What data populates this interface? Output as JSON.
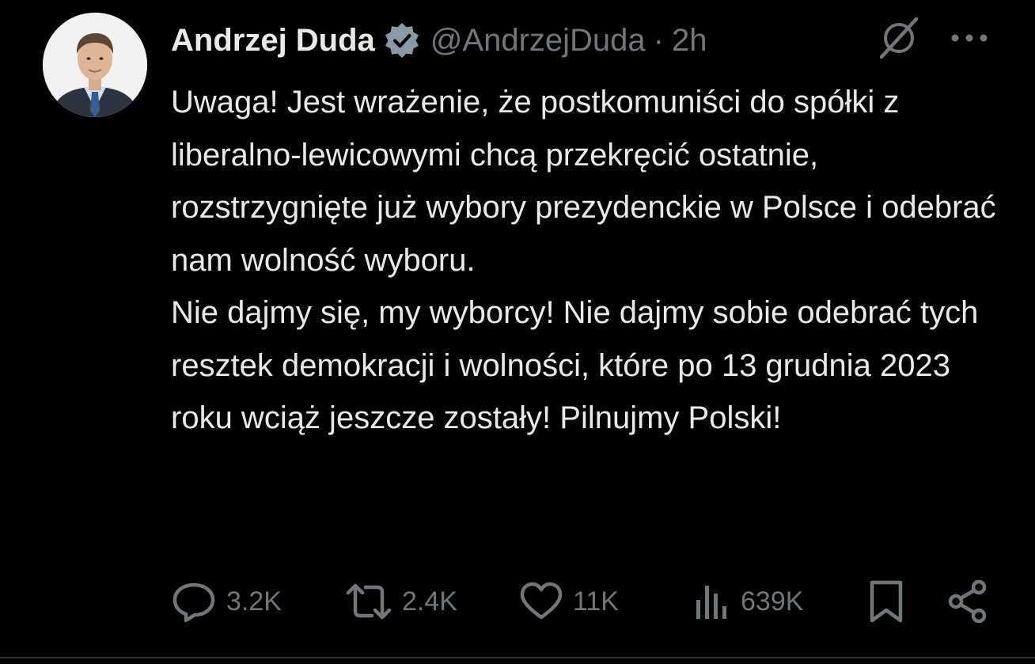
{
  "tweet": {
    "author_name": "Andrzej Duda",
    "handle": "@AndrzejDuda",
    "separator": "·",
    "time": "2h",
    "verified": true,
    "verified_badge_color": "#8b98a5",
    "avatar_icon": "avatar",
    "paragraphs": [
      "Uwaga! Jest wrażenie, że postkomuniści do spółki z liberalno-lewicowymi chcą przekręcić ostatnie, rozstrzygnięte już wybory prezydenckie w Polsce i odebrać nam wolność wyboru.",
      "Nie dajmy się, my wyborcy! Nie dajmy sobie odebrać tych resztek demokracji i wolności, które po 13 grudnia 2023 roku wciąż jeszcze zostały! Pilnujmy Polski!"
    ]
  },
  "actions": {
    "replies": "3.2K",
    "reposts": "2.4K",
    "likes": "11K",
    "views": "639K"
  },
  "icons": {
    "reply": "reply-icon",
    "repost": "repost-icon",
    "like": "like-icon",
    "views": "views-icon",
    "bookmark": "bookmark-icon",
    "share": "share-icon",
    "grok": "grok-icon",
    "more": "more-icon"
  },
  "colors": {
    "background": "#000000",
    "text": "#e7e9ea",
    "secondary": "#71767b",
    "divider": "#2f3336"
  }
}
